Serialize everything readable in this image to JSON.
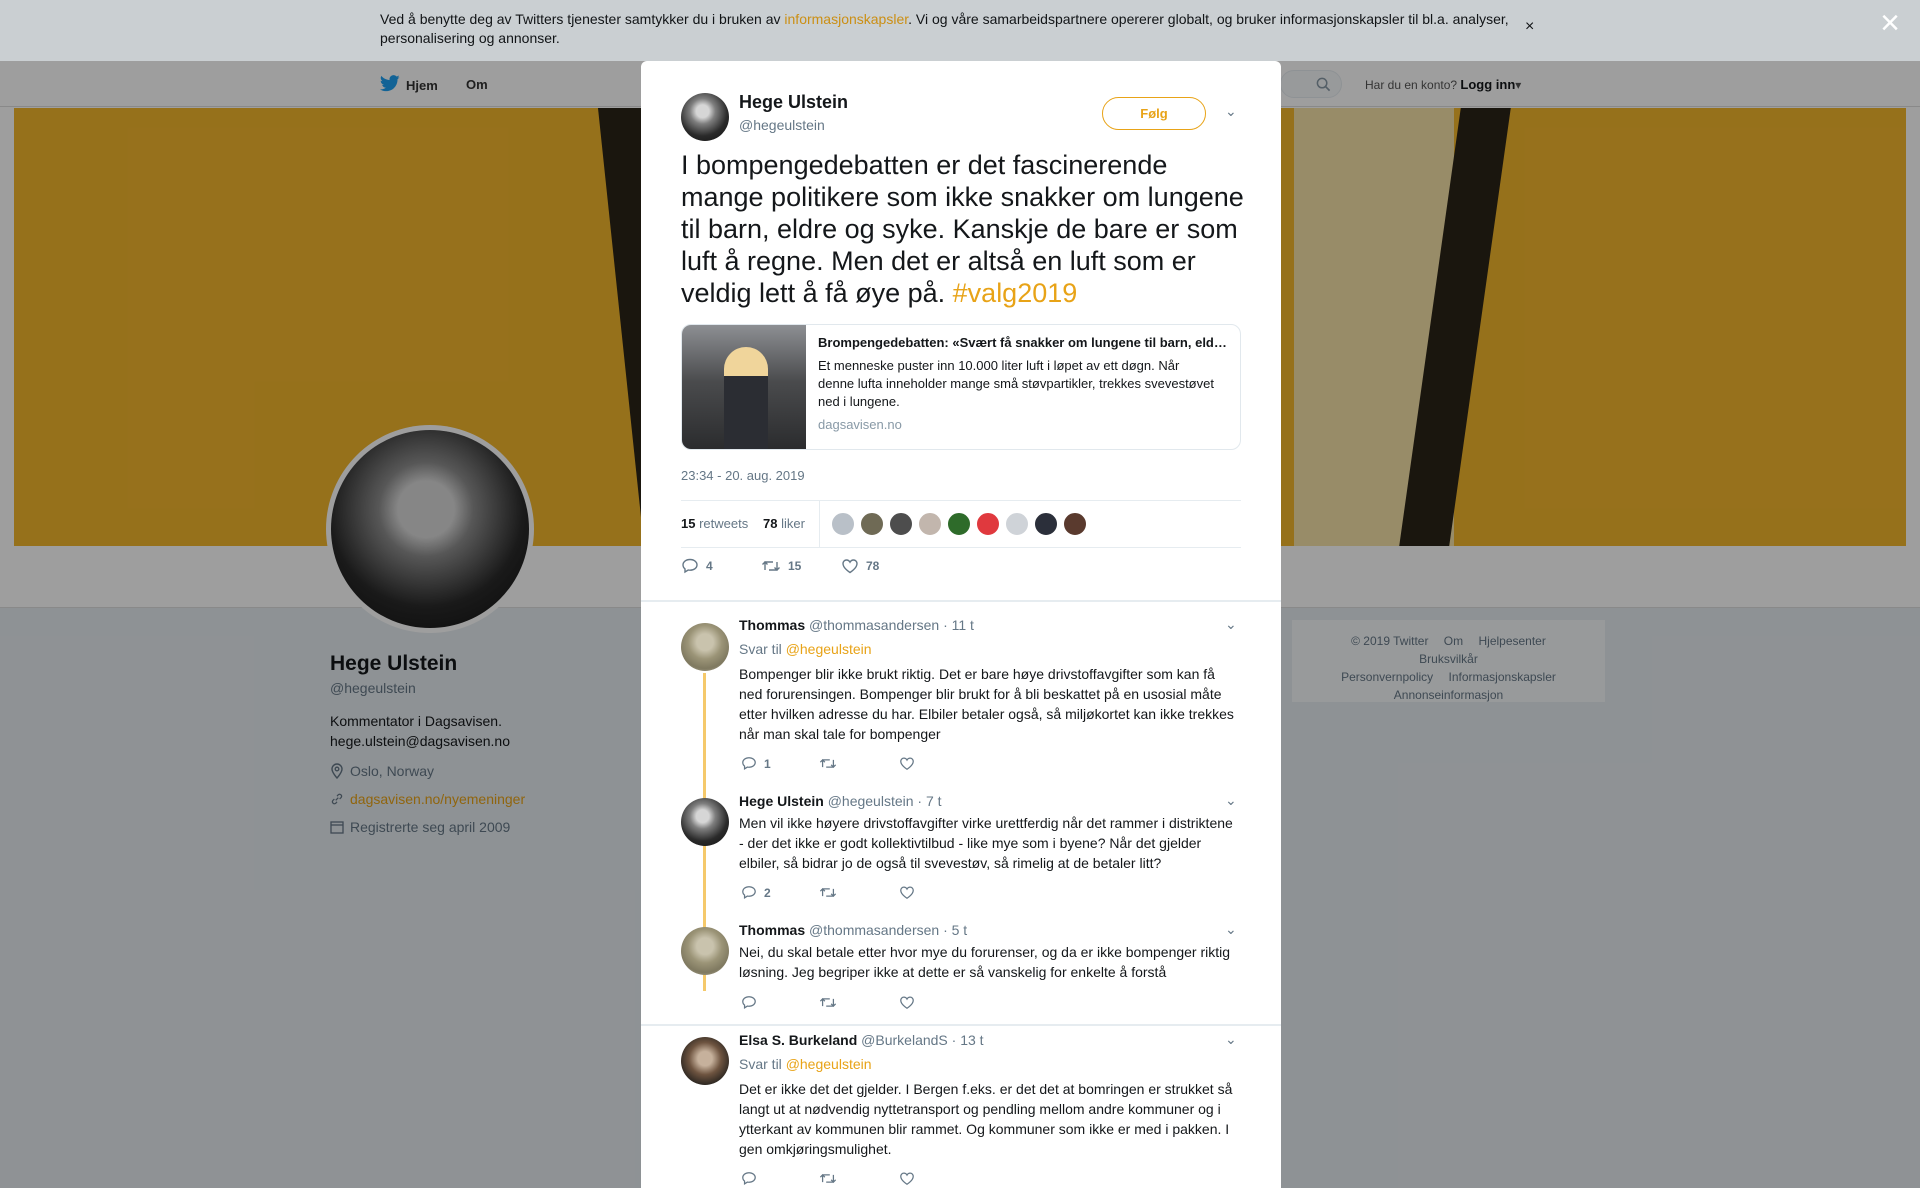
{
  "cookie": {
    "text_before": "Ved å benytte deg av Twitters tjenester samtykker du i bruken av ",
    "link": "informasjonskapsler",
    "text_after": ". Vi og våre samarbeidspartnere opererer globalt, og bruker informasjonskapsler til bl.a. analyser, personalisering og annonser.",
    "close": "×"
  },
  "modal_close": "×",
  "nav": {
    "home": "Hjem",
    "about": "Om",
    "account_prompt": "Har du en konto?",
    "login": "Logg inn"
  },
  "profile": {
    "name": "Hege Ulstein",
    "handle": "@hegeulstein",
    "bio_line1": "Kommentator i Dagsavisen.",
    "bio_line2": "hege.ulstein@dagsavisen.no",
    "location": "Oslo, Norway",
    "website": "dagsavisen.no/nyemeninger",
    "joined": "Registrerte seg april 2009"
  },
  "footer": {
    "items": [
      "© 2019 Twitter",
      "Om",
      "Hjelpesenter",
      "Bruksvilkår",
      "Personvernpolicy",
      "Informasjonskapsler",
      "Annonseinformasjon"
    ]
  },
  "tweet": {
    "name": "Hege Ulstein",
    "handle": "@hegeulstein",
    "follow": "Følg",
    "text": "I bompengedebatten er det fascinerende mange politikere som ikke snakker om lungene til barn, eldre og syke. Kanskje de bare er som luft å regne. Men det er altså en luft som er veldig lett å få øye på. ",
    "hashtag": "#valg2019",
    "card": {
      "title": "Brompengedebatten: «Svært få snakker om lungene til barn, eldre og syke»",
      "description": "Et menneske puster inn 10.000 liter luft i løpet av ett døgn. Når denne lufta inneholder mange små støvpartikler, trekkes svevestøvet ned i lungene.",
      "domain": "dagsavisen.no"
    },
    "timestamp": "23:34 - 20. aug. 2019",
    "retweets_count": "15",
    "retweets_label": "retweets",
    "likes_count": "78",
    "likes_label": "liker",
    "liker_colors": [
      "#b9c0c8",
      "#6f6a55",
      "#4d4d4d",
      "#c2b6ad",
      "#2e6b2a",
      "#e0393e",
      "#cfd3d8",
      "#2b2f3a",
      "#5a3a2e"
    ],
    "actions": {
      "replies": "4",
      "retweets": "15",
      "likes": "78"
    }
  },
  "replies": [
    {
      "name": "Thommas",
      "handle": "@thommasandersen",
      "time": "· 11 t",
      "reply_prefix": "Svar til",
      "reply_to": "@hegeulstein",
      "text": "Bompenger blir ikke brukt riktig. Det er bare høye drivstoffavgifter som kan få ned forurensingen. Bompenger blir brukt for å bli beskattet på en usosial måte etter hvilken adresse du har. Elbiler betaler også, så miljøkortet kan ikke trekkes når man skal tale for bompenger",
      "reply_count": "1"
    },
    {
      "name": "Hege Ulstein",
      "handle": "@hegeulstein",
      "time": "· 7 t",
      "text": "Men vil ikke høyere drivstoffavgifter virke urettferdig når det rammer i distriktene - der det ikke er godt kollektivtilbud - like mye som i byene? Når det gjelder elbiler, så bidrar jo de også til svevestøv, så rimelig at de betaler litt?",
      "reply_count": "2"
    },
    {
      "name": "Thommas",
      "handle": "@thommasandersen",
      "time": "· 5 t",
      "text": "Nei, du skal betale etter hvor mye du forurenser, og da er ikke bompenger riktig løsning. Jeg begriper ikke at dette er så vanskelig for enkelte å forstå"
    },
    {
      "name": "Elsa S. Burkeland",
      "handle": "@BurkelandS",
      "time": "· 13 t",
      "reply_prefix": "Svar til",
      "reply_to": "@hegeulstein",
      "text": "Det er ikke det det gjelder. I Bergen f.eks. er det det at bomringen er strukket så langt ut at nødvendig nyttetransport og pendling mellom andre kommuner og i ytterkant av kommunen blir rammet. Og kommuner som ikke er med i pakken. I gen omkjøringsmulighet."
    }
  ],
  "colors": {
    "accent": "#e8a317",
    "banner": "#f3b62d"
  }
}
